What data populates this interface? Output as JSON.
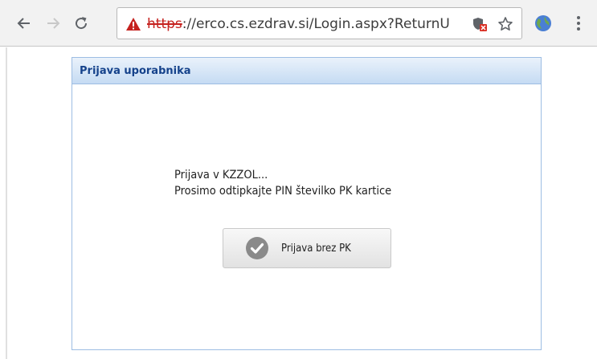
{
  "browser": {
    "back_icon": "arrow-left-icon",
    "forward_icon": "arrow-right-icon",
    "reload_icon": "reload-icon",
    "address_bar": {
      "security_icon": "warning-triangle-icon",
      "scheme": "https",
      "separator": "://",
      "host_and_path": "erco.cs.ezdrav.si/Login.aspx?ReturnU",
      "security_color": "#c5221f"
    },
    "page_action_icon": "shield-blocked-icon",
    "bookmark_icon": "star-icon",
    "extension_icon": "globe-icon",
    "menu_icon": "more-vertical-icon"
  },
  "login_panel": {
    "title": "Prijava uporabnika",
    "header_text_color": "#15428b",
    "message_line1": "Prijava v KZZOL...",
    "message_line2": "Prosimo odtipkajte PIN številko PK kartice",
    "button": {
      "icon": "checkmark-circle-icon",
      "label": "Prijava brez PK"
    }
  }
}
